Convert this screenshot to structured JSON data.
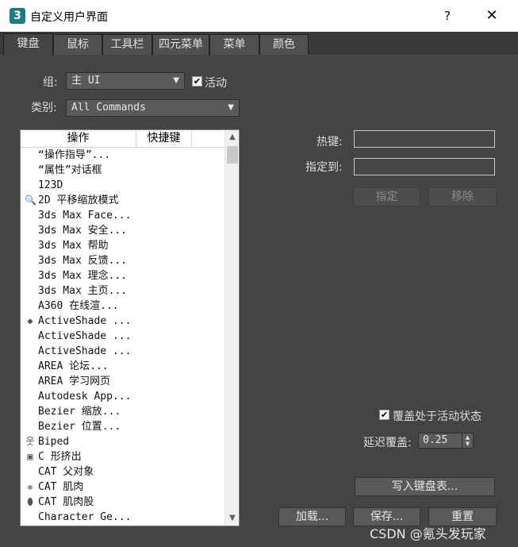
{
  "window": {
    "title": "自定义用户界面",
    "help_label": "?",
    "close_label": "✕",
    "app_icon": "3"
  },
  "tabs": [
    {
      "label": "键盘",
      "active": true
    },
    {
      "label": "鼠标"
    },
    {
      "label": "工具栏"
    },
    {
      "label": "四元菜单"
    },
    {
      "label": "菜单"
    },
    {
      "label": "颜色"
    }
  ],
  "group": {
    "label": "组:",
    "value": "主 UI",
    "active_label": "活动",
    "active_checked": true
  },
  "category": {
    "label": "类别:",
    "value": "All Commands"
  },
  "list": {
    "col_action": "操作",
    "col_shortcut": "快捷键",
    "rows": [
      {
        "text": "“操作指导”..."
      },
      {
        "text": "“属性”对话框"
      },
      {
        "text": "123D"
      },
      {
        "text": "2D 平移缩放模式",
        "icon": "magnifier-icon"
      },
      {
        "text": "3ds Max Face..."
      },
      {
        "text": "3ds Max 安全..."
      },
      {
        "text": "3ds Max 帮助"
      },
      {
        "text": "3ds Max 反馈..."
      },
      {
        "text": "3ds Max 理念..."
      },
      {
        "text": "3ds Max 主页..."
      },
      {
        "text": "A360 在线渲..."
      },
      {
        "text": "ActiveShade ...",
        "icon": "teapot-icon"
      },
      {
        "text": "ActiveShade ..."
      },
      {
        "text": "ActiveShade ..."
      },
      {
        "text": "AREA 论坛..."
      },
      {
        "text": "AREA 学习网页"
      },
      {
        "text": "Autodesk App..."
      },
      {
        "text": "Bezier 缩放..."
      },
      {
        "text": "Bezier 位置..."
      },
      {
        "text": "Biped",
        "icon": "biped-icon"
      },
      {
        "text": "C 形挤出",
        "icon": "box-icon"
      },
      {
        "text": "CAT 父对象"
      },
      {
        "text": "CAT 肌肉",
        "icon": "muscle-icon"
      },
      {
        "text": "CAT 肌肉股",
        "icon": "muscle-strand-icon"
      },
      {
        "text": "Character Ge..."
      }
    ]
  },
  "hotkey": {
    "label": "热键:",
    "value": ""
  },
  "assigned": {
    "label": "指定到:",
    "value": ""
  },
  "buttons": {
    "assign": "指定",
    "remove": "移除",
    "write_keyboard_chart": "写入键盘表...",
    "load": "加载...",
    "save": "保存...",
    "reset": "重置"
  },
  "override": {
    "label": "覆盖处于活动状态",
    "checked": true
  },
  "delay": {
    "label": "延迟覆盖:",
    "value": "0.25"
  },
  "watermark": "CSDN @氪头发玩家"
}
